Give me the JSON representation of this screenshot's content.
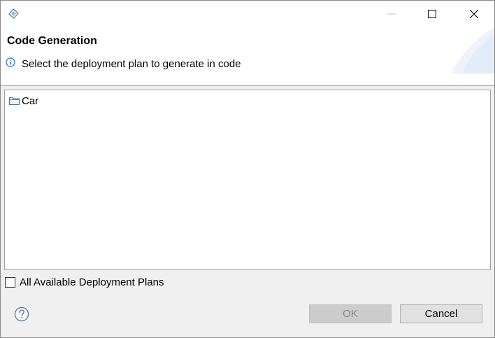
{
  "window": {
    "icons": {
      "app": "app-icon",
      "minimize": "minimize-icon",
      "maximize": "maximize-icon",
      "close": "close-icon"
    }
  },
  "header": {
    "title": "Code Generation",
    "message": "Select the deployment plan to generate in code",
    "message_icon": "info-icon"
  },
  "tree": {
    "items": [
      {
        "label": "Car",
        "icon": "folder-icon"
      }
    ]
  },
  "options": {
    "all_plans_label": "All Available Deployment Plans",
    "all_plans_checked": false
  },
  "footer": {
    "help_icon": "help-icon",
    "ok_label": "OK",
    "ok_enabled": false,
    "cancel_label": "Cancel"
  },
  "colors": {
    "header_bg": "#ffffff",
    "dialog_bg": "#f0f0f0",
    "accent": "#2b6cb0",
    "disabled_text": "#8a8a8a"
  }
}
